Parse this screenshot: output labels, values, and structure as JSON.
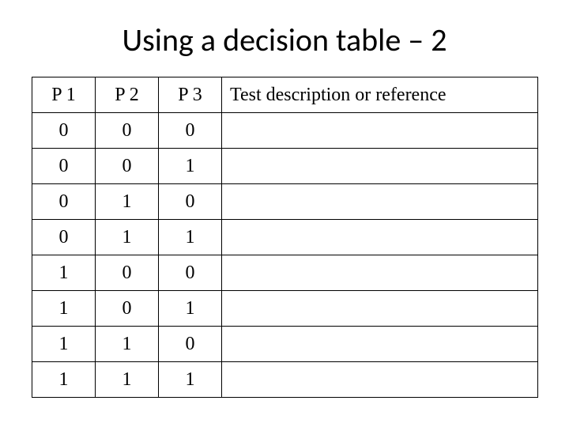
{
  "title": "Using a decision table – 2",
  "chart_data": {
    "type": "table",
    "headers": [
      "P 1",
      "P 2",
      "P 3",
      "Test description or reference"
    ],
    "rows": [
      [
        "0",
        "0",
        "0",
        ""
      ],
      [
        "0",
        "0",
        "1",
        ""
      ],
      [
        "0",
        "1",
        "0",
        ""
      ],
      [
        "0",
        "1",
        "1",
        ""
      ],
      [
        "1",
        "0",
        "0",
        ""
      ],
      [
        "1",
        "0",
        "1",
        ""
      ],
      [
        "1",
        "1",
        "0",
        ""
      ],
      [
        "1",
        "1",
        "1",
        ""
      ]
    ]
  }
}
